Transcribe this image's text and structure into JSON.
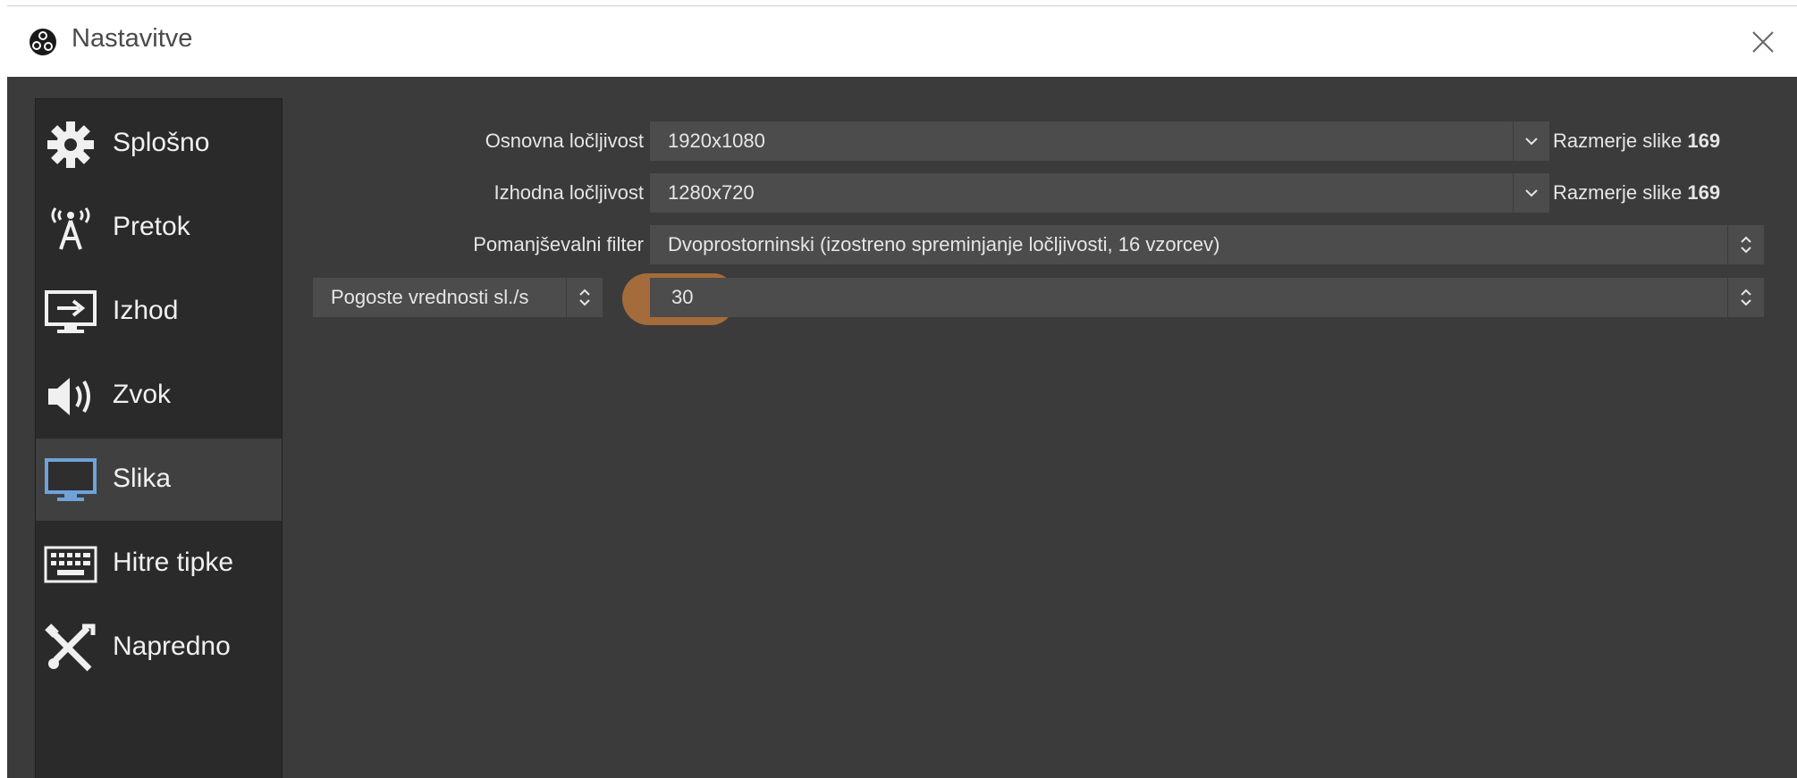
{
  "window": {
    "title": "Nastavitve",
    "icons": {
      "logo": "obs-logo-icon",
      "close": "close-icon"
    }
  },
  "sidebar": {
    "items": [
      {
        "label": "Splošno",
        "icon": "gear-icon",
        "active": false
      },
      {
        "label": "Pretok",
        "icon": "antenna-icon",
        "active": false
      },
      {
        "label": "Izhod",
        "icon": "output-monitor-icon",
        "active": false
      },
      {
        "label": "Zvok",
        "icon": "speaker-icon",
        "active": false
      },
      {
        "label": "Slika",
        "icon": "monitor-icon",
        "active": true
      },
      {
        "label": "Hitre tipke",
        "icon": "keyboard-icon",
        "active": false
      },
      {
        "label": "Napredno",
        "icon": "tools-icon",
        "active": false
      }
    ]
  },
  "video": {
    "base_resolution": {
      "label": "Osnovna ločljivost",
      "value": "1920x1080",
      "aspect_label": "Razmerje slike",
      "aspect_value": "169"
    },
    "output_resolution": {
      "label": "Izhodna ločljivost",
      "value": "1280x720",
      "aspect_label": "Razmerje slike",
      "aspect_value": "169"
    },
    "downscale_filter": {
      "label": "Pomanjševalni filter",
      "value": "Dvoprostorninski (izostreno spreminjanje ločljivosti, 16 vzorcev)"
    },
    "fps": {
      "type_value": "Pogoste vrednosti sl./s",
      "value": "30"
    }
  },
  "colors": {
    "dialog_bg": "#3b3b3b",
    "sidebar_bg": "#2a2a2a",
    "field_bg": "#4c4c4c",
    "active_item": "#404040",
    "highlight": "#c27a3a",
    "monitor_accent": "#6fa3d8"
  }
}
